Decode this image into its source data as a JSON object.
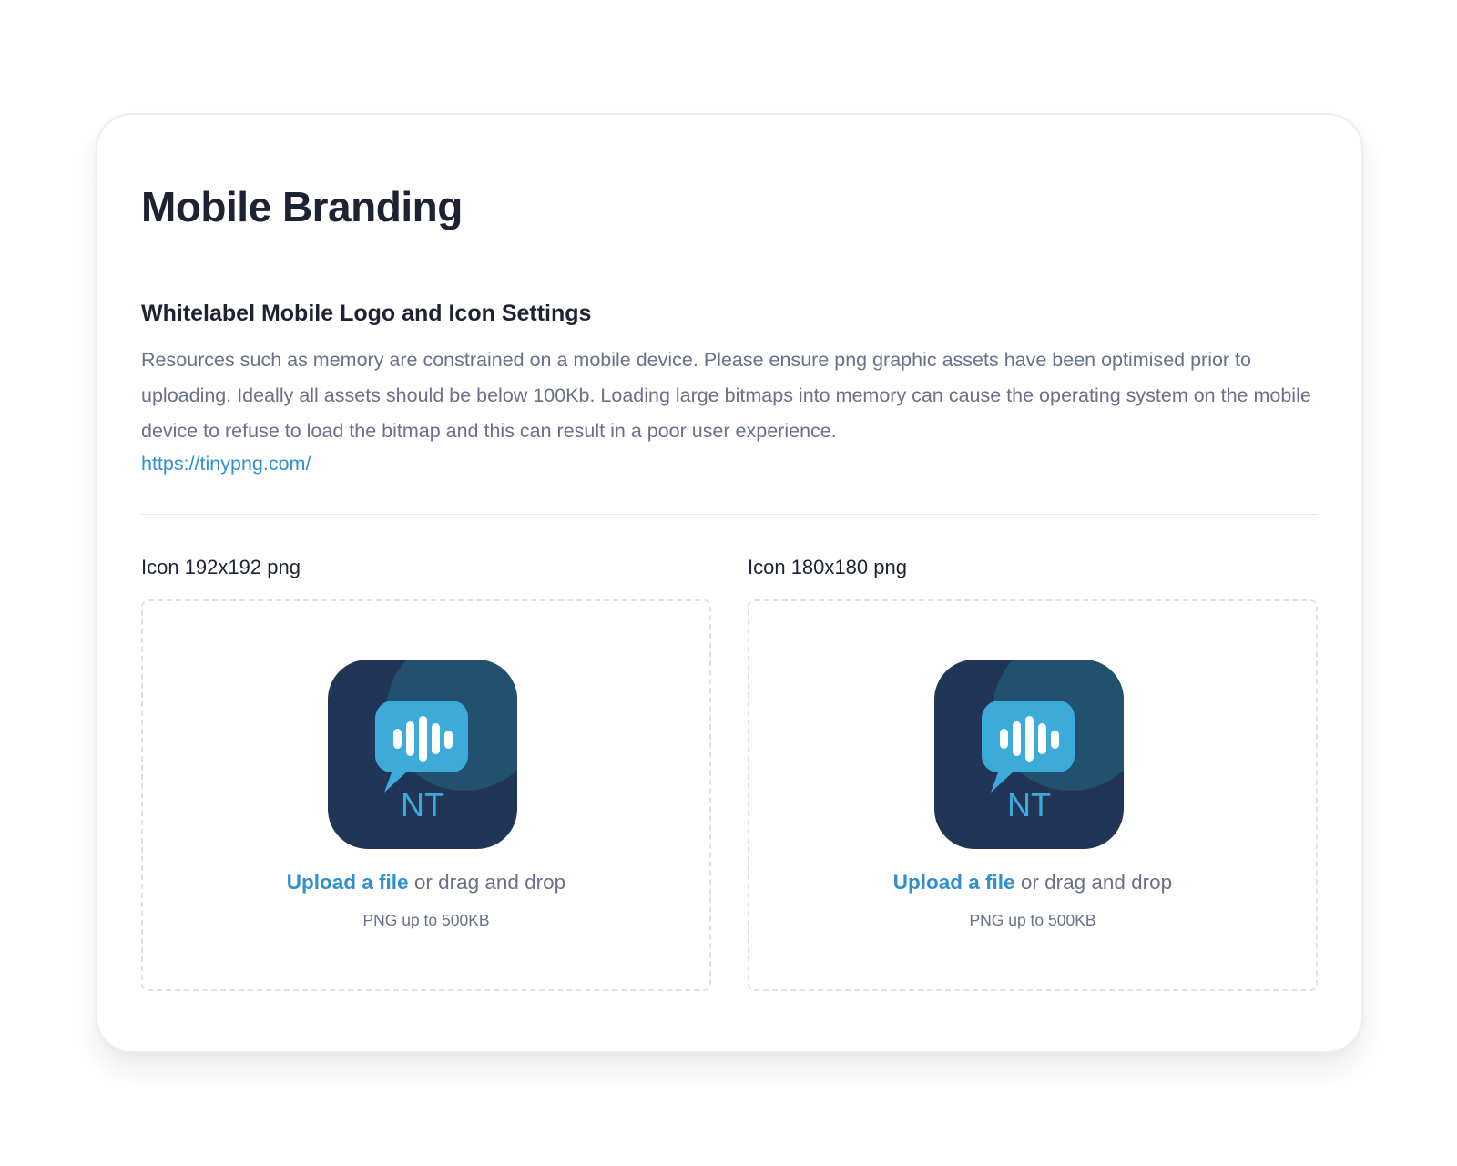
{
  "page": {
    "title": "Mobile Branding"
  },
  "section": {
    "title": "Whitelabel Mobile Logo and Icon Settings",
    "description": "Resources such as memory are constrained on a mobile device. Please ensure png graphic assets have been optimised prior to uploading. Ideally all assets should be below 100Kb. Loading large bitmaps into memory can cause the operating system on the mobile device to refuse to load the bitmap and this can result in a poor user experience.",
    "link": "https://tinypng.com/"
  },
  "uploads": [
    {
      "label": "Icon 192x192 png",
      "upload_link": "Upload a file",
      "upload_rest": " or drag and drop",
      "hint": "PNG up to 500KB",
      "preview_text": "NT"
    },
    {
      "label": "Icon 180x180 png",
      "upload_link": "Upload a file",
      "upload_rest": " or drag and drop",
      "hint": "PNG up to 500KB",
      "preview_text": "NT"
    }
  ],
  "colors": {
    "accent": "#2f8fd0",
    "heading": "#1e2333",
    "muted": "#69718a",
    "icon_bg": "#213657",
    "icon_circle": "#22506f",
    "icon_bubble": "#3cabd9"
  },
  "icons": {
    "preview": "chat-bubble-soundwave-logo-icon"
  }
}
